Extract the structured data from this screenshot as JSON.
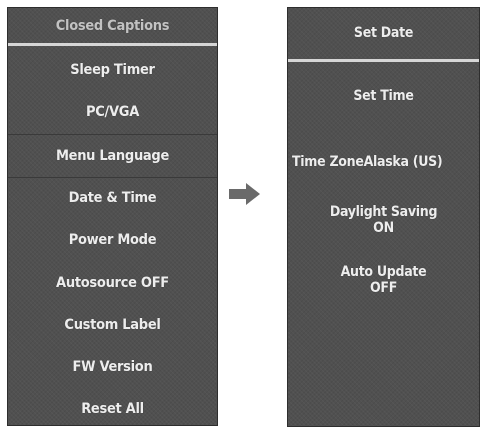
{
  "left_menu": {
    "items": [
      {
        "label": "Closed Captions"
      },
      {
        "label": "Sleep Timer"
      },
      {
        "label": "PC/VGA"
      },
      {
        "label": "Menu Language"
      },
      {
        "label": "Date & Time"
      },
      {
        "label": "Power Mode"
      },
      {
        "label": "Autosource OFF"
      },
      {
        "label": "Custom Label"
      },
      {
        "label": "FW Version"
      },
      {
        "label": "Reset All"
      }
    ]
  },
  "arrow": {
    "icon": "arrow-right-icon",
    "color": "#6a6a6a"
  },
  "right_menu": {
    "set_date": "Set Date",
    "set_time": "Set Time",
    "time_zone_label": "Time Zone",
    "time_zone_value": "Alaska (US)",
    "daylight_saving_label": "Daylight Saving",
    "daylight_saving_value": "ON",
    "auto_update_label": "Auto Update",
    "auto_update_value": "OFF"
  },
  "colors": {
    "panel_bg": "#505050",
    "text": "#ededed",
    "divider": "#d6d6d6"
  }
}
